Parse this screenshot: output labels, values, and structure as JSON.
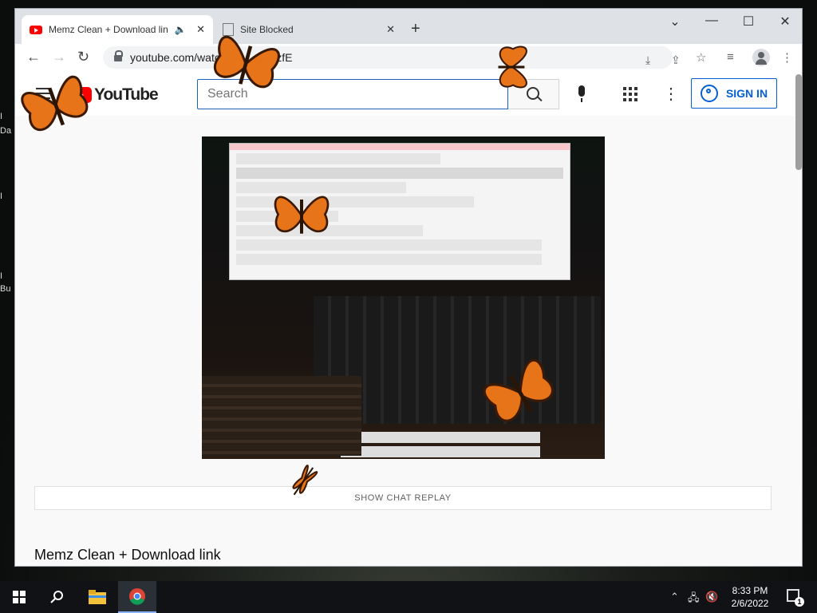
{
  "desktop": {
    "labels": [
      "I",
      "Da",
      "I",
      "I",
      "Bu"
    ]
  },
  "browser": {
    "tabs": [
      {
        "title": "Memz Clean + Download lin",
        "favicon": "youtube-icon",
        "audio": true,
        "active": true
      },
      {
        "title": "Site Blocked",
        "favicon": "page-icon",
        "active": false
      }
    ],
    "new_tab_label": "+",
    "window_controls": {
      "menu": "⌄",
      "minimize": "—",
      "maximize": "☐",
      "close": "✕"
    },
    "url": "youtube.com/watch?v=…NFczfE"
  },
  "youtube": {
    "logo_text": "YouTube",
    "search_placeholder": "Search",
    "sign_in_label": "SIGN IN",
    "show_chat_replay_label": "SHOW CHAT REPLAY",
    "video_title": "Memz Clean + Download link"
  },
  "taskbar": {
    "time": "8:33 PM",
    "date": "2/6/2022",
    "notification_count": "1",
    "items": [
      "start-icon",
      "search-icon",
      "file-explorer-icon",
      "chrome-icon"
    ]
  },
  "colors": {
    "yt_red": "#ff0000",
    "link_blue": "#065fd4",
    "butterfly_orange": "#e8741a"
  }
}
